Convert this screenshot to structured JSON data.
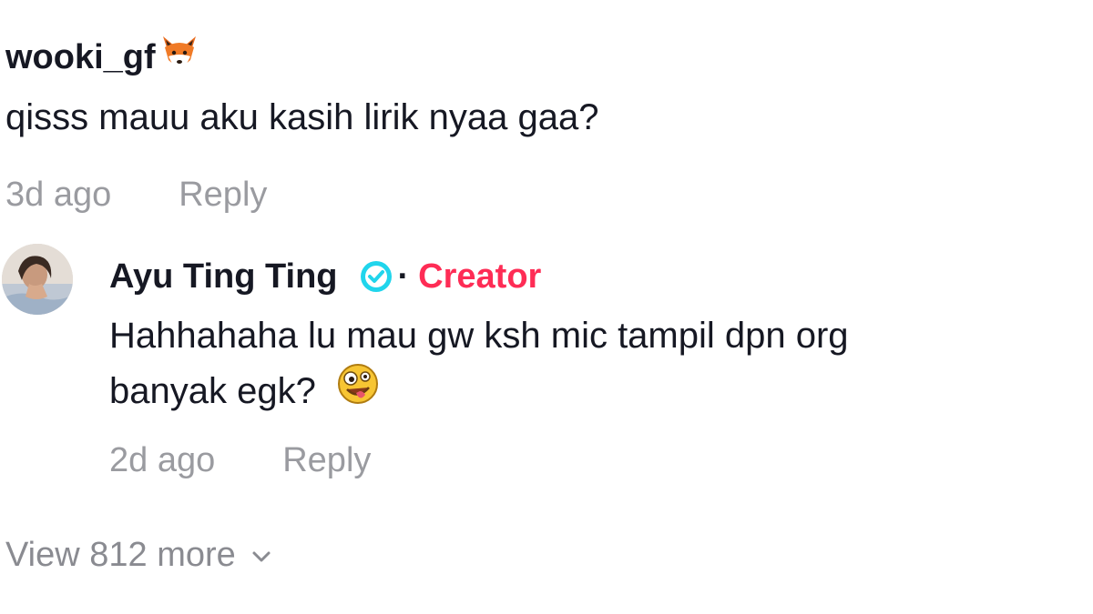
{
  "comments": [
    {
      "username": "wooki_gf",
      "username_emoji": "fox-icon",
      "text": "qisss mauu aku kasih lirik nyaa gaa?",
      "time": "3d ago",
      "reply_label": "Reply"
    }
  ],
  "reply": {
    "username": "Ayu Ting Ting",
    "verified": "verified-badge-icon",
    "separator": "·",
    "role_badge": "Creator",
    "text_line1": "Hahhahaha lu mau gw ksh mic tampil dpn org",
    "text_line2": "banyak egk?",
    "text_emoji": "zany-face-icon",
    "time": "2d ago",
    "reply_label": "Reply"
  },
  "view_more": {
    "label": "View 812 more",
    "icon": "chevron-down-icon"
  },
  "colors": {
    "text": "#161823",
    "muted": "#9a9ba0",
    "creator": "#fe2c55",
    "verified": "#20d5ec"
  }
}
